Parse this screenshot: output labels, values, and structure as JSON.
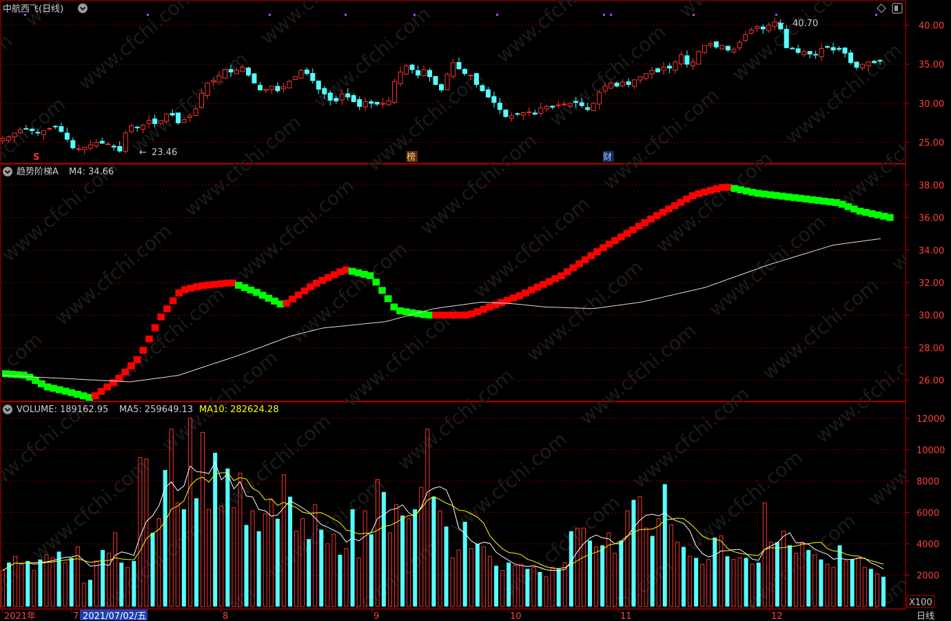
{
  "header": {
    "title": "中航西飞(日线)",
    "hi_label": "40.70",
    "lo_label": "23.46",
    "marker_s": "S",
    "marker_bang": "榜",
    "marker_cai": "财"
  },
  "ind_header": {
    "name": "趋势阶梯A",
    "m4_label": "M4: 34.66"
  },
  "vol_header": {
    "volume": "VOLUME: 189162.95",
    "ma5": "MA5: 259649.13",
    "ma10": "MA10: 282624.28",
    "unit": "X100"
  },
  "footer": {
    "period": "日线"
  },
  "colors": {
    "up": "#ff3232",
    "down": "#54ffff",
    "ladder_up": "#ff0000",
    "ladder_down": "#00ff00",
    "ma5": "#ffffff",
    "ma10": "#ffff00",
    "grid": "#7a0000"
  },
  "chart_data": [
    {
      "type": "candlestick",
      "name": "price",
      "ylim": [
        22.5,
        42.5
      ],
      "yticks": [
        25.0,
        30.0,
        35.0,
        40.0
      ],
      "tick_labels": [
        "25.00",
        "30.00",
        "35.00",
        "40.00"
      ],
      "hi": 40.7,
      "lo": 23.46,
      "seed_close": [
        25.5,
        25.7,
        26.2,
        26.6,
        26.7,
        26.5,
        26.2,
        26.5,
        26.8,
        27.0,
        26.4,
        25.4,
        24.3,
        24.2,
        24.4,
        24.7,
        25.0,
        24.9,
        24.8,
        24.4,
        23.9,
        26.2,
        27.1,
        26.9,
        27.2,
        27.8,
        27.4,
        27.8,
        28.6,
        28.5,
        27.5,
        27.9,
        28.4,
        29.3,
        31.3,
        32.6,
        32.9,
        33.5,
        34.3,
        34.0,
        34.2,
        34.6,
        33.6,
        32.6,
        31.7,
        31.8,
        32.2,
        31.6,
        32.1,
        32.8,
        33.4,
        34.2,
        33.8,
        32.9,
        31.8,
        31.2,
        30.4,
        30.3,
        31.2,
        30.8,
        30.2,
        29.6,
        30.2,
        30.0,
        29.9,
        30.0,
        30.3,
        32.8,
        34.0,
        34.8,
        34.3,
        33.6,
        34.3,
        33.4,
        32.4,
        31.7,
        33.7,
        35.2,
        34.4,
        33.8,
        33.6,
        32.4,
        31.6,
        30.8,
        30.1,
        29.2,
        28.3,
        28.4,
        28.6,
        28.8,
        28.9,
        28.6,
        29.4,
        29.6,
        29.5,
        29.8,
        29.9,
        30.0,
        30.1,
        29.7,
        29.2,
        30.0,
        31.4,
        32.2,
        32.6,
        32.2,
        32.7,
        32.4,
        33.0,
        33.4,
        33.8,
        34.2,
        34.0,
        34.6,
        34.5,
        35.3,
        36.2,
        35.0,
        35.3,
        36.6,
        37.4,
        37.6,
        37.2,
        37.4,
        36.8,
        36.9,
        37.8,
        38.8,
        39.4,
        39.8,
        39.5,
        40.0,
        40.4,
        39.5,
        37.1,
        37.0,
        36.5,
        36.6,
        36.3,
        36.2,
        37.0,
        37.2,
        36.8,
        36.9,
        36.4,
        35.2,
        34.6,
        35.0,
        35.3,
        35.2,
        35.4
      ]
    },
    {
      "type": "line",
      "name": "趋势阶梯A",
      "ylim": [
        24.8,
        39.2
      ],
      "yticks": [
        26.0,
        28.0,
        30.0,
        32.0,
        34.0,
        36.0,
        38.0
      ],
      "tick_labels": [
        "26.00",
        "28.00",
        "30.00",
        "32.00",
        "34.00",
        "36.00",
        "38.00"
      ],
      "M4": 34.66,
      "ladder": [
        [
          0,
          26.4
        ],
        [
          10,
          26.3
        ],
        [
          20,
          25.6
        ],
        [
          30,
          25.3
        ],
        [
          42,
          24.9
        ],
        [
          55,
          26.1
        ],
        [
          65,
          27.4
        ],
        [
          75,
          29.8
        ],
        [
          85,
          31.5
        ],
        [
          95,
          31.8
        ],
        [
          110,
          32.0
        ],
        [
          122,
          31.4
        ],
        [
          135,
          30.6
        ],
        [
          150,
          31.9
        ],
        [
          165,
          32.8
        ],
        [
          178,
          32.4
        ],
        [
          190,
          30.3
        ],
        [
          205,
          30.0
        ],
        [
          225,
          30.0
        ],
        [
          250,
          31.2
        ],
        [
          270,
          32.4
        ],
        [
          290,
          34.1
        ],
        [
          315,
          36.0
        ],
        [
          335,
          37.4
        ],
        [
          350,
          37.9
        ],
        [
          365,
          37.5
        ],
        [
          385,
          37.2
        ],
        [
          405,
          36.9
        ],
        [
          415,
          36.4
        ],
        [
          430,
          36.0
        ]
      ],
      "ma": [
        [
          0,
          26.3
        ],
        [
          40,
          26.1
        ],
        [
          80,
          25.9
        ],
        [
          110,
          26.3
        ],
        [
          150,
          27.6
        ],
        [
          180,
          28.7
        ],
        [
          200,
          29.2
        ],
        [
          240,
          29.6
        ],
        [
          270,
          30.4
        ],
        [
          300,
          30.8
        ],
        [
          320,
          30.7
        ],
        [
          340,
          30.5
        ],
        [
          370,
          30.4
        ],
        [
          400,
          30.8
        ],
        [
          440,
          31.7
        ],
        [
          480,
          33.1
        ],
        [
          520,
          34.3
        ],
        [
          550,
          34.7
        ]
      ]
    },
    {
      "type": "bar",
      "name": "VOLUME",
      "ylim": [
        0,
        12300
      ],
      "yticks": [
        2000,
        4000,
        6000,
        8000,
        10000,
        12000
      ],
      "tick_labels": [
        "2000",
        "4000",
        "6000",
        "8000",
        "10000",
        "12000"
      ],
      "volume": 189162.95,
      "ma5": 259649.13,
      "ma10": 282624.28,
      "values": [
        2300,
        2800,
        3200,
        2700,
        2900,
        2300,
        3000,
        3300,
        3100,
        3500,
        2800,
        3100,
        3800,
        1500,
        1700,
        2900,
        3600,
        3400,
        4700,
        2800,
        2500,
        2900,
        9500,
        9400,
        4700,
        5600,
        8700,
        11300,
        6600,
        6200,
        12000,
        6900,
        11100,
        6200,
        9800,
        6400,
        8800,
        6300,
        8500,
        5200,
        6100,
        4800,
        5900,
        6800,
        5600,
        8400,
        7000,
        4800,
        5600,
        4300,
        6500,
        4900,
        4000,
        4600,
        3300,
        3700,
        6200,
        3100,
        6100,
        4600,
        8100,
        7300,
        4700,
        6500,
        5800,
        5600,
        6200,
        7600,
        11300,
        7000,
        6100,
        5100,
        3100,
        3600,
        5400,
        3700,
        4000,
        3800,
        3200,
        2600,
        2300,
        2800,
        2600,
        2700,
        2400,
        2500,
        2200,
        1900,
        2500,
        2400,
        2800,
        4800,
        5000,
        5000,
        4200,
        3800,
        3900,
        4700,
        3400,
        4200,
        6100,
        6800,
        7000,
        5000,
        4500,
        5600,
        7800,
        5200,
        4100,
        3800,
        3200,
        3100,
        2700,
        3000,
        4400,
        4500,
        3200,
        3000,
        3100,
        3100,
        2700,
        2800,
        6600,
        4100,
        4100,
        4800,
        3900,
        3400,
        4100,
        3600,
        3300,
        3000,
        2700,
        2500,
        3900,
        2900,
        3000,
        3100,
        2500,
        2400,
        2100,
        1900
      ]
    }
  ],
  "x_axis": {
    "labels": [
      "2021年",
      "7",
      "2021/07/02/五",
      "8",
      "9",
      "10",
      "11",
      "12"
    ]
  }
}
